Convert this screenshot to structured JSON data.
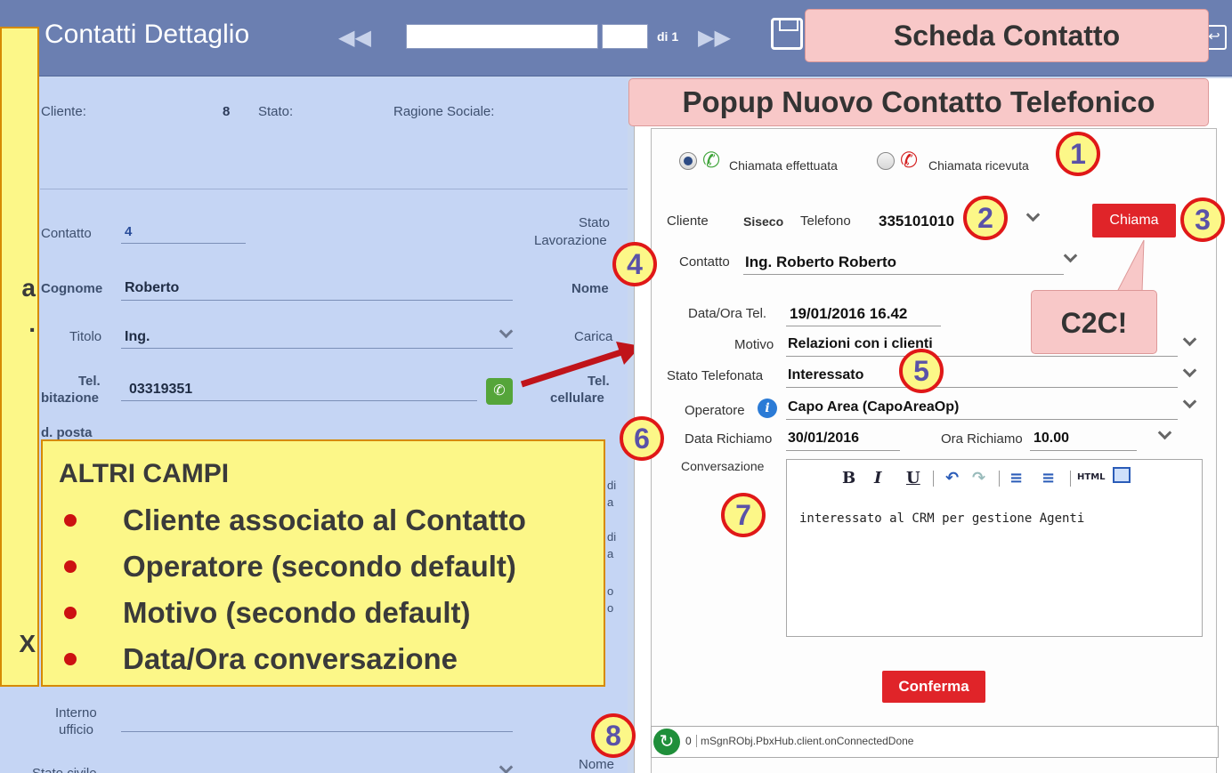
{
  "window": {
    "title": "Contatti Dettaglio",
    "nav_of": "di 1"
  },
  "form": {
    "cliente_label": "Cliente:",
    "cliente_value": "8",
    "stato_label": "Stato:",
    "ragione_label": "Ragione Sociale:",
    "contatto_label": "Contatto",
    "contatto_value": "4",
    "stato_lav_label1": "Stato",
    "stato_lav_label2": "Lavorazione",
    "cognome_label": "Cognome",
    "cognome_value": "Roberto",
    "nome_label": "Nome",
    "titolo_label": "Titolo",
    "titolo_value": "Ing.",
    "carica_label": "Carica",
    "tel_ab_label1": "Tel.",
    "tel_ab_label2": "bitazione",
    "tel_ab_value": "03319351",
    "tel_cell_label1": "Tel.",
    "tel_cell_label2": "cellulare",
    "posta_label": "d. posta",
    "interno_label1": "Interno",
    "interno_label2": "ufficio",
    "stato_civile_label": "Stato civile",
    "nome2_label": "Nome",
    "partial_labels": [
      "di",
      "a",
      "di",
      "a",
      "o",
      "o"
    ]
  },
  "left_box": {
    "letters": [
      "a",
      ".",
      "X"
    ]
  },
  "callout": {
    "title": "ALTRI CAMPI",
    "items": [
      "Cliente associato al Contatto",
      "Operatore (secondo default)",
      "Motivo (secondo default)",
      "Data/Ora conversazione"
    ]
  },
  "labels": {
    "scheda": "Scheda Contatto",
    "popup_title": "Popup Nuovo Contatto Telefonico",
    "c2c": "C2C!",
    "numbers": [
      "1",
      "2",
      "3",
      "4",
      "5",
      "6",
      "7",
      "8"
    ]
  },
  "popup": {
    "radio_out": "Chiamata effettuata",
    "radio_in": "Chiamata ricevuta",
    "cliente_label": "Cliente",
    "cliente_value": "Siseco",
    "telefono_label": "Telefono",
    "telefono_value": "335101010",
    "chiama": "Chiama",
    "contatto_label": "Contatto",
    "contatto_value": "Ing. Roberto Roberto",
    "dataora_label": "Data/Ora Tel.",
    "dataora_value": "19/01/2016 16.42",
    "motivo_label": "Motivo",
    "motivo_value": "Relazioni con i clienti",
    "stato_label": "Stato Telefonata",
    "stato_value": "Interessato",
    "operatore_label": "Operatore",
    "operatore_value": "Capo Area (CapoAreaOp)",
    "richiamo_label": "Data Richiamo",
    "richiamo_value": "30/01/2016",
    "ora_label": "Ora Richiamo",
    "ora_value": "10.00",
    "conversazione_label": "Conversazione",
    "conversazione_text": "interessato al CRM per gestione Agenti",
    "conferma": "Conferma",
    "status_count": "0",
    "status_msg": "mSgnRObj.PbxHub.client.onConnectedDone"
  },
  "editor_toolbar": {
    "bold": "B",
    "italic": "I",
    "underline": "U",
    "html": "HTML"
  },
  "colors": {
    "title_bar": "#6b7fb1",
    "form_bg": "#c5d5f4",
    "accent_red": "#e02429",
    "callout_yellow": "#fcf788",
    "pink_label": "#f8c8c8"
  }
}
